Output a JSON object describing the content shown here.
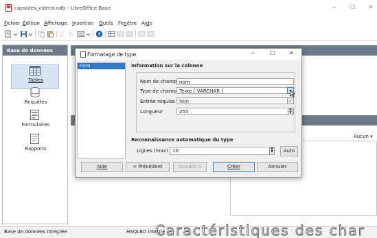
{
  "window": {
    "title": "capsules_videos.odb - LibreOffice Base",
    "controls": [
      "─",
      "☐",
      "✕"
    ]
  },
  "menu": {
    "items": [
      {
        "pre": "",
        "u": "F",
        "post": "ichier"
      },
      {
        "pre": "",
        "u": "É",
        "post": "dition"
      },
      {
        "pre": "",
        "u": "A",
        "post": "ffichage"
      },
      {
        "pre": "",
        "u": "I",
        "post": "nsertion"
      },
      {
        "pre": "",
        "u": "O",
        "post": "utils"
      },
      {
        "pre": "Fe",
        "u": "n",
        "post": "être"
      },
      {
        "pre": "Ai",
        "u": "d",
        "post": "e"
      }
    ]
  },
  "left_panel": {
    "header": "Base de données",
    "categories": [
      {
        "label": "Tables",
        "icon": "table-icon",
        "selected": true
      },
      {
        "label": "Requêtes",
        "icon": "query-icon",
        "selected": false
      },
      {
        "label": "Formulaires",
        "icon": "form-icon",
        "selected": false
      },
      {
        "label": "Rapports",
        "icon": "report-icon",
        "selected": false
      }
    ]
  },
  "main": {
    "aucun": "Aucun ▾"
  },
  "status": {
    "left": "Base de données intégrée",
    "middle": "HSQLBD intégré"
  },
  "overlay": {
    "caption": "Caractéristiques des char"
  },
  "dialog": {
    "title": "Formatage de type",
    "controls": [
      "─",
      "☐",
      "✕"
    ],
    "field_list": [
      "nom"
    ],
    "section_info": "Information sur la colonne",
    "props": {
      "nom_label": "Nom de champ",
      "nom_value": "nom",
      "type_label": "Type de champ",
      "type_value": "Texte [ VARCHAR ]",
      "entree_label": "Entrée requise",
      "entree_value": "Non",
      "longueur_label": "Longueur",
      "longueur_value": "255"
    },
    "section_auto": "Reconnaissance automatique du type",
    "lignes_label": "Lignes (max) :",
    "lignes_value": "10",
    "auto_button": "Auto",
    "buttons": {
      "aide": "Aide",
      "precedent": "< Précédent",
      "suivant": "Suivant >",
      "creer": "Créer",
      "annuler": "Annuler"
    }
  }
}
